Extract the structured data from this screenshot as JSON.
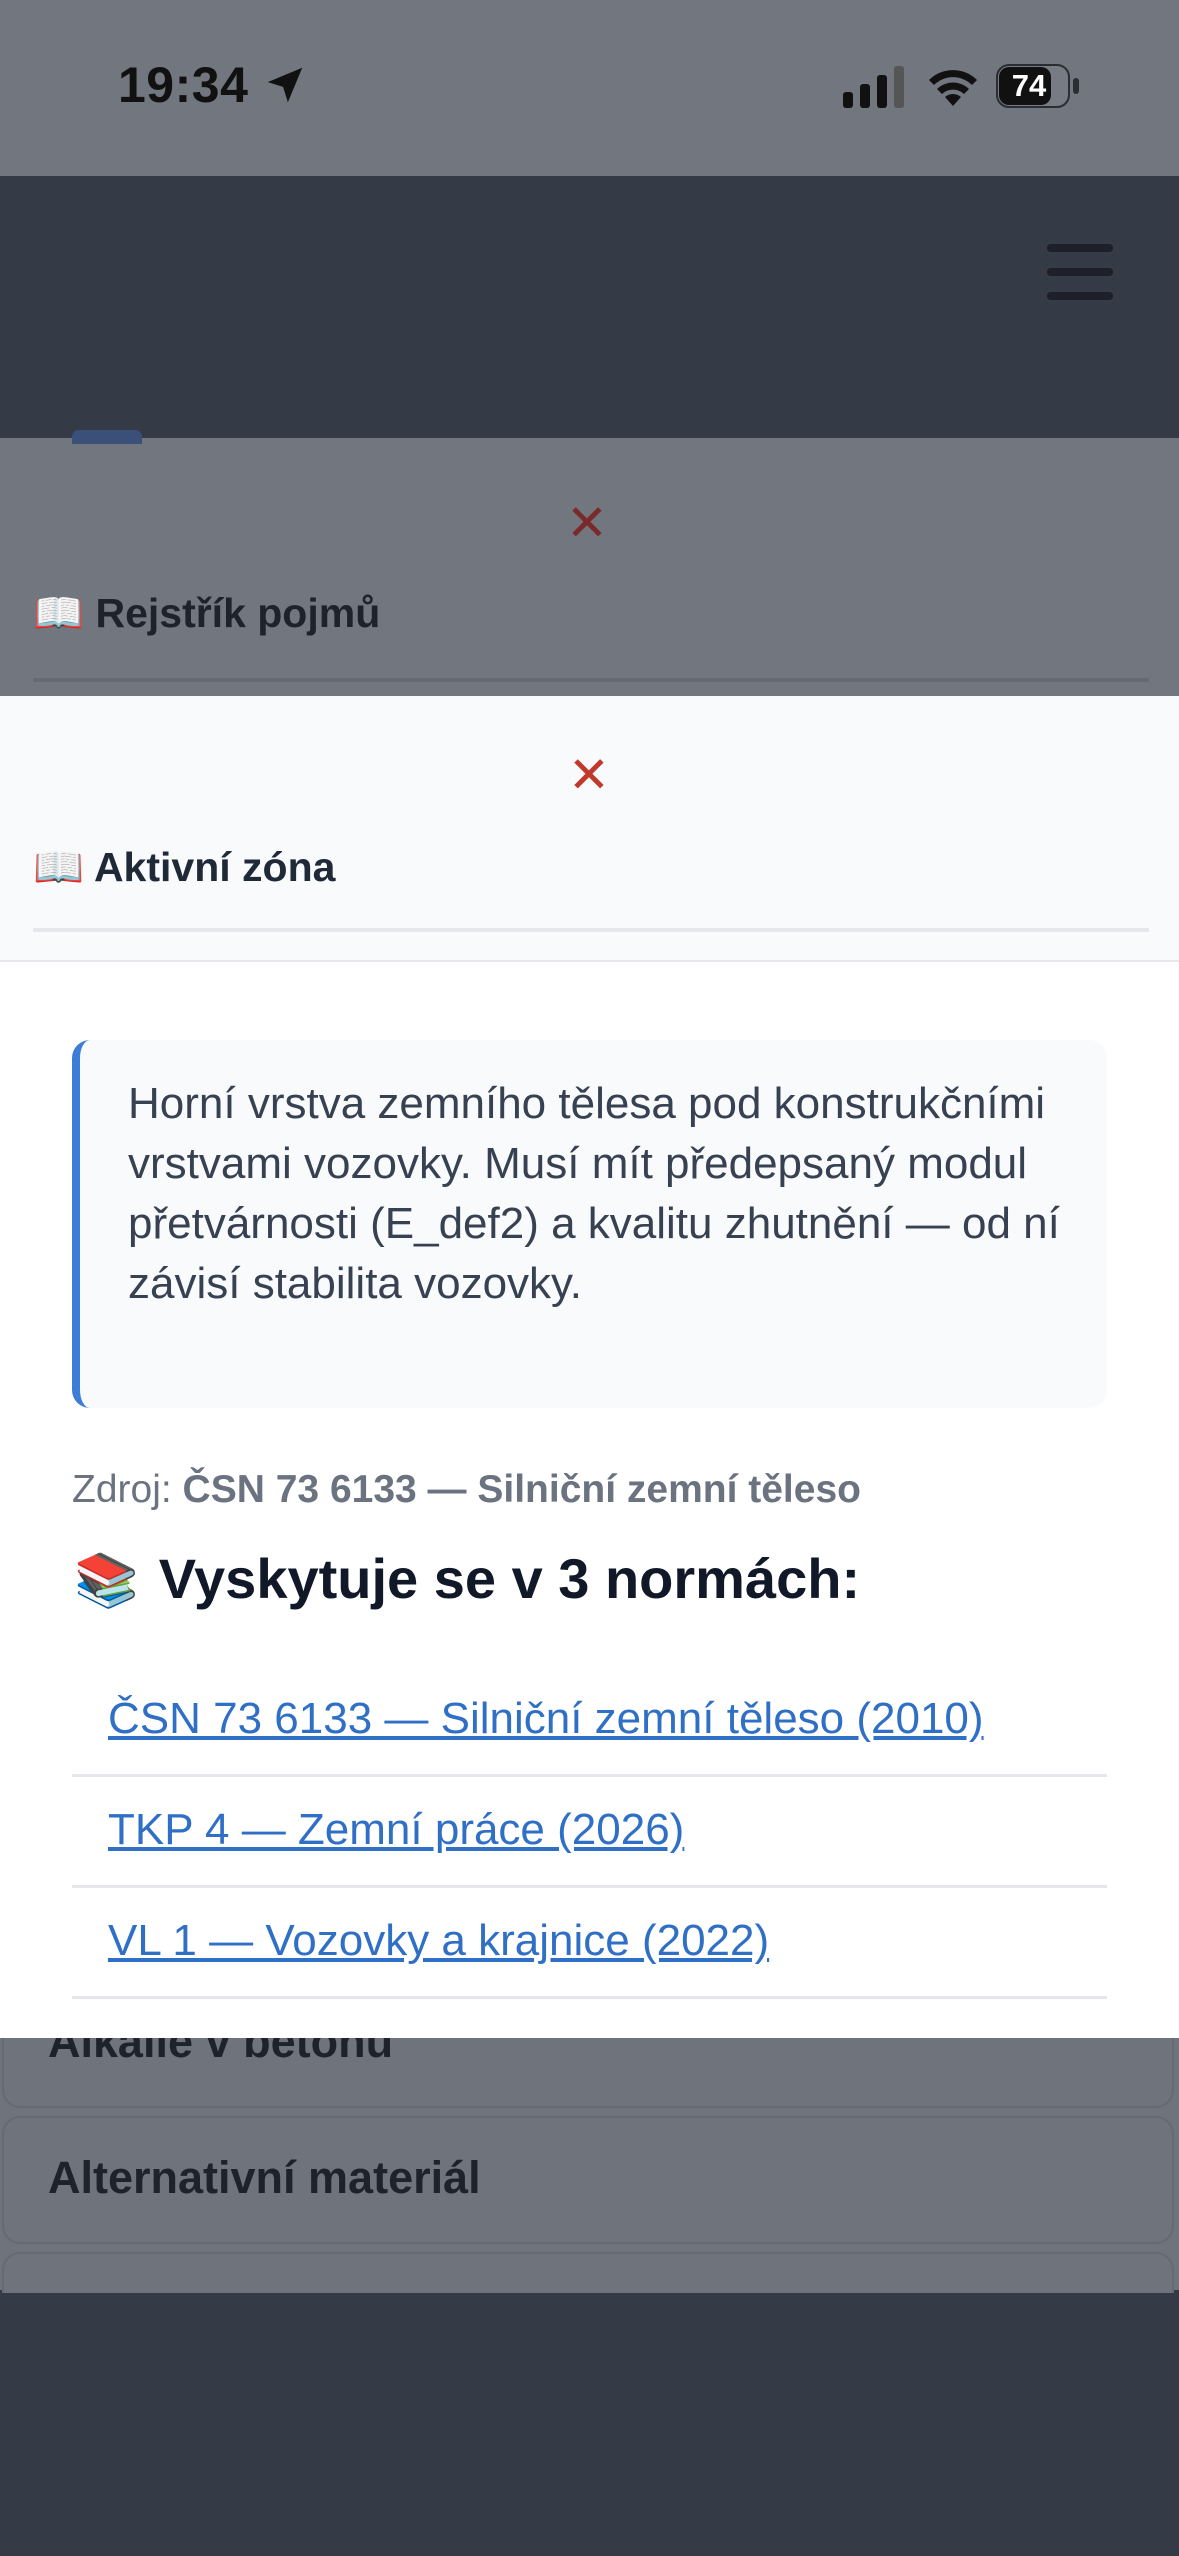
{
  "status_bar": {
    "time": "19:34",
    "battery": "74"
  },
  "background_list": {
    "items": [
      "Alkálie v betonu",
      "Alternativní materiál"
    ]
  },
  "modal_back": {
    "close": "✕",
    "title_icon": "📖",
    "title": "Rejstřík pojmů"
  },
  "modal_front": {
    "close": "✕",
    "title_icon": "📖",
    "title": "Aktivní zóna",
    "definition": "Horní vrstva zemního tělesa pod konstrukčními vrstvami vozovky. Musí mít předepsaný modul přetvárnosti (E_def2) a kvalitu zhutnění — od ní závisí stabilita vozovky.",
    "source_label": "Zdroj:",
    "source_value": "ČSN 73 6133 — Silniční zemní těleso",
    "occurs_icon": "📚",
    "occurs_title": "Vyskytuje se v 3 normách:",
    "norms": [
      "ČSN 73 6133 — Silniční zemní těleso (2010)",
      "TKP 4 — Zemní práce (2026)",
      "VL 1 — Vozovky a krajnice (2022)"
    ]
  },
  "colors": {
    "accent": "#3b7dd8",
    "link": "#2f6fc6",
    "close": "#c0392b"
  }
}
